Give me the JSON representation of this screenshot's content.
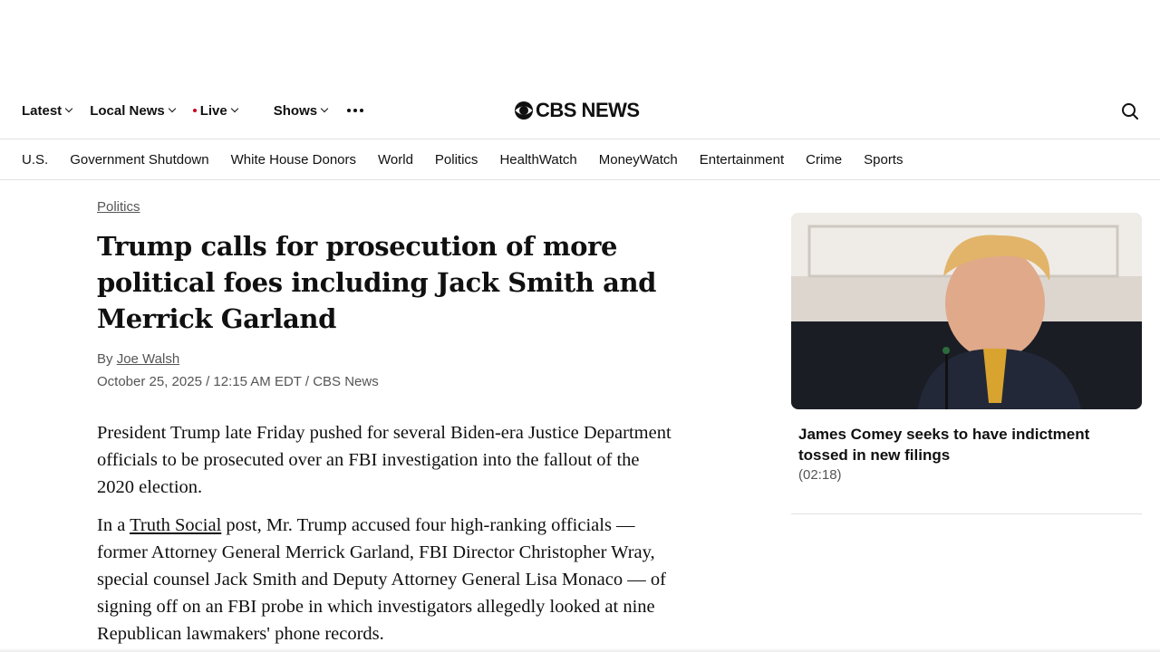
{
  "top_nav": {
    "items": [
      {
        "label": "Latest"
      },
      {
        "label": "Local News"
      },
      {
        "label": "Live"
      },
      {
        "label": "Shows"
      }
    ]
  },
  "logo": {
    "text": "CBS NEWS"
  },
  "sub_nav": {
    "items": [
      "U.S.",
      "Government Shutdown",
      "White House Donors",
      "World",
      "Politics",
      "HealthWatch",
      "MoneyWatch",
      "Entertainment",
      "Crime",
      "Sports"
    ]
  },
  "article": {
    "kicker": "Politics",
    "headline": "Trump calls for prosecution of more political foes including Jack Smith and Merrick Garland",
    "byline_prefix": "By",
    "author": "Joe Walsh",
    "dateline": "October 25, 2025 / 12:15 AM EDT / CBS News",
    "para1": "President Trump late Friday pushed for several Biden-era Justice Department officials to be prosecuted over an FBI investigation into the fallout of the 2020 election.",
    "para2_prefix": "In a",
    "para2_link": "Truth Social",
    "para2_rest": " post, Mr. Trump accused four high-ranking officials — former Attorney General Merrick Garland, FBI Director Christopher Wray, special counsel Jack Smith and Deputy Attorney General Lisa Monaco — of signing off on an FBI probe in which investigators allegedly looked at nine Republican lawmakers' phone records."
  },
  "sidebar": {
    "video_title": "James Comey seeks to have indictment tossed in new filings",
    "video_duration": "(02:18)"
  },
  "colors": {
    "live_dot": "#d0021b",
    "text": "#101010",
    "muted": "#555555",
    "divider": "#e1e1e1"
  }
}
